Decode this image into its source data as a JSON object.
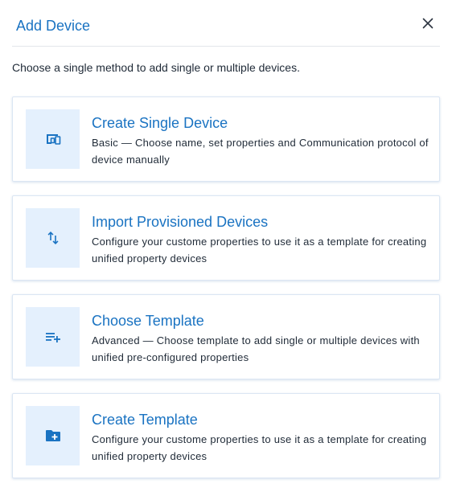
{
  "dialog": {
    "title": "Add Device",
    "close_icon": "close-icon",
    "subtitle": "Choose a single method to add single or multiple devices."
  },
  "options": [
    {
      "title": "Create Single Device",
      "description": "Basic — Choose name, set properties and Communication protocol of device manually",
      "icon": "device-icon"
    },
    {
      "title": "Import Provisioned Devices",
      "description": "Configure your custome properties to use it as a template for creating unified property devices",
      "icon": "swap-vertical-icon"
    },
    {
      "title": "Choose Template",
      "description": "Advanced — Choose template to add single or multiple devices with unified pre-configured properties",
      "icon": "playlist-add-icon"
    },
    {
      "title": "Create Template",
      "description": "Configure your custome properties to use it as a template for creating unified property devices",
      "icon": "folder-add-icon"
    }
  ],
  "colors": {
    "accent": "#1a73c2",
    "icon_bg": "#e4f0fd",
    "card_border": "#dbe6f3",
    "divider": "#e3e6ea",
    "text": "#1f2a37"
  }
}
